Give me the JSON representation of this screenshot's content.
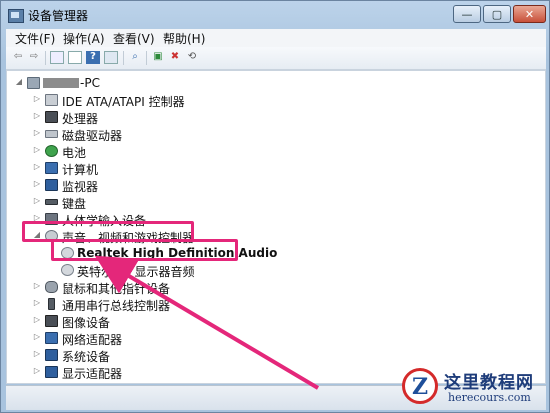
{
  "window": {
    "title": "设备管理器",
    "min_glyph": "—",
    "max_glyph": "▢",
    "close_glyph": "✕"
  },
  "menu": [
    "文件(F)",
    "操作(A)",
    "查看(V)",
    "帮助(H)"
  ],
  "toolbar_icons": [
    "back-icon",
    "forward-icon",
    "show-hide-icon",
    "properties-icon",
    "help-icon",
    "view-icon",
    "scan-icon",
    "update-driver-icon",
    "disable-icon",
    "uninstall-icon"
  ],
  "tree": {
    "root": "-PC",
    "items": [
      "IDE ATA/ATAPI 控制器",
      "处理器",
      "磁盘驱动器",
      "电池",
      "计算机",
      "监视器",
      "键盘",
      "人体学输入设备",
      "声音、视频和游戏控制器",
      "Realtek High Definition Audio",
      "英特尔(R) 显示器音频",
      "鼠标和其他指针设备",
      "通用串行总线控制器",
      "图像设备",
      "网络适配器",
      "系统设备",
      "显示适配器"
    ]
  },
  "watermark": {
    "logo_glyph": "Z",
    "name": "这里教程网",
    "site": "herecours.com"
  },
  "colors": {
    "highlight": "#e4277a",
    "watermark": "#1e3c7a"
  }
}
